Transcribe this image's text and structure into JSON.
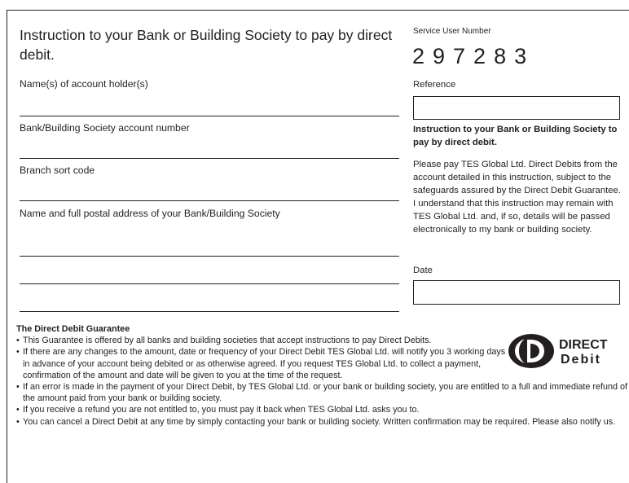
{
  "form": {
    "title": "Instruction to your Bank or Building Society to pay by direct debit.",
    "fields": [
      {
        "label": "Name(s) of account holder(s)"
      },
      {
        "label": "Bank/Building Society account number"
      },
      {
        "label": "Branch sort code"
      },
      {
        "label": "Name and full postal address of your Bank/Building Society"
      }
    ]
  },
  "service_user": {
    "label": "Service User Number",
    "number": "297283"
  },
  "reference": {
    "label": "Reference",
    "value": ""
  },
  "instruction": {
    "heading": "Instruction to your Bank or Building Society to pay by direct debit.",
    "body": "Please pay TES Global Ltd. Direct Debits from the account detailed in this instruction, subject to the safeguards assured by the Direct Debit Guarantee. I understand that this instruction may remain with TES Global Ltd. and, if so, details will be passed electronically to my bank or building society."
  },
  "date": {
    "label": "Date",
    "value": ""
  },
  "guarantee": {
    "title": "The Direct Debit Guarantee",
    "items": [
      "This Guarantee is offered by all banks and building societies that accept instructions to pay Direct Debits.",
      "If there are any changes to the amount, date or frequency of your Direct Debit TES Global Ltd. will notify you 3 working days in advance of your account being debited or as otherwise agreed. If you request TES Global Ltd. to collect a payment, confirmation of the amount and date will be given to you at the time of the request.",
      "If an error is made in the payment of your Direct Debit, by TES Global Ltd. or your bank or building society, you are entitled to a full and immediate refund of the amount paid from your bank or building society.",
      "If you receive a refund you are not entitled to, you must pay it back when TES Global Ltd. asks you to.",
      "You can cancel a Direct Debit at any time by simply contacting your bank or building society. Written confirmation may be required. Please also notify us."
    ]
  },
  "logo": {
    "line1": "DIRECT",
    "line2": "Debit",
    "icon": "direct-debit-logo"
  }
}
